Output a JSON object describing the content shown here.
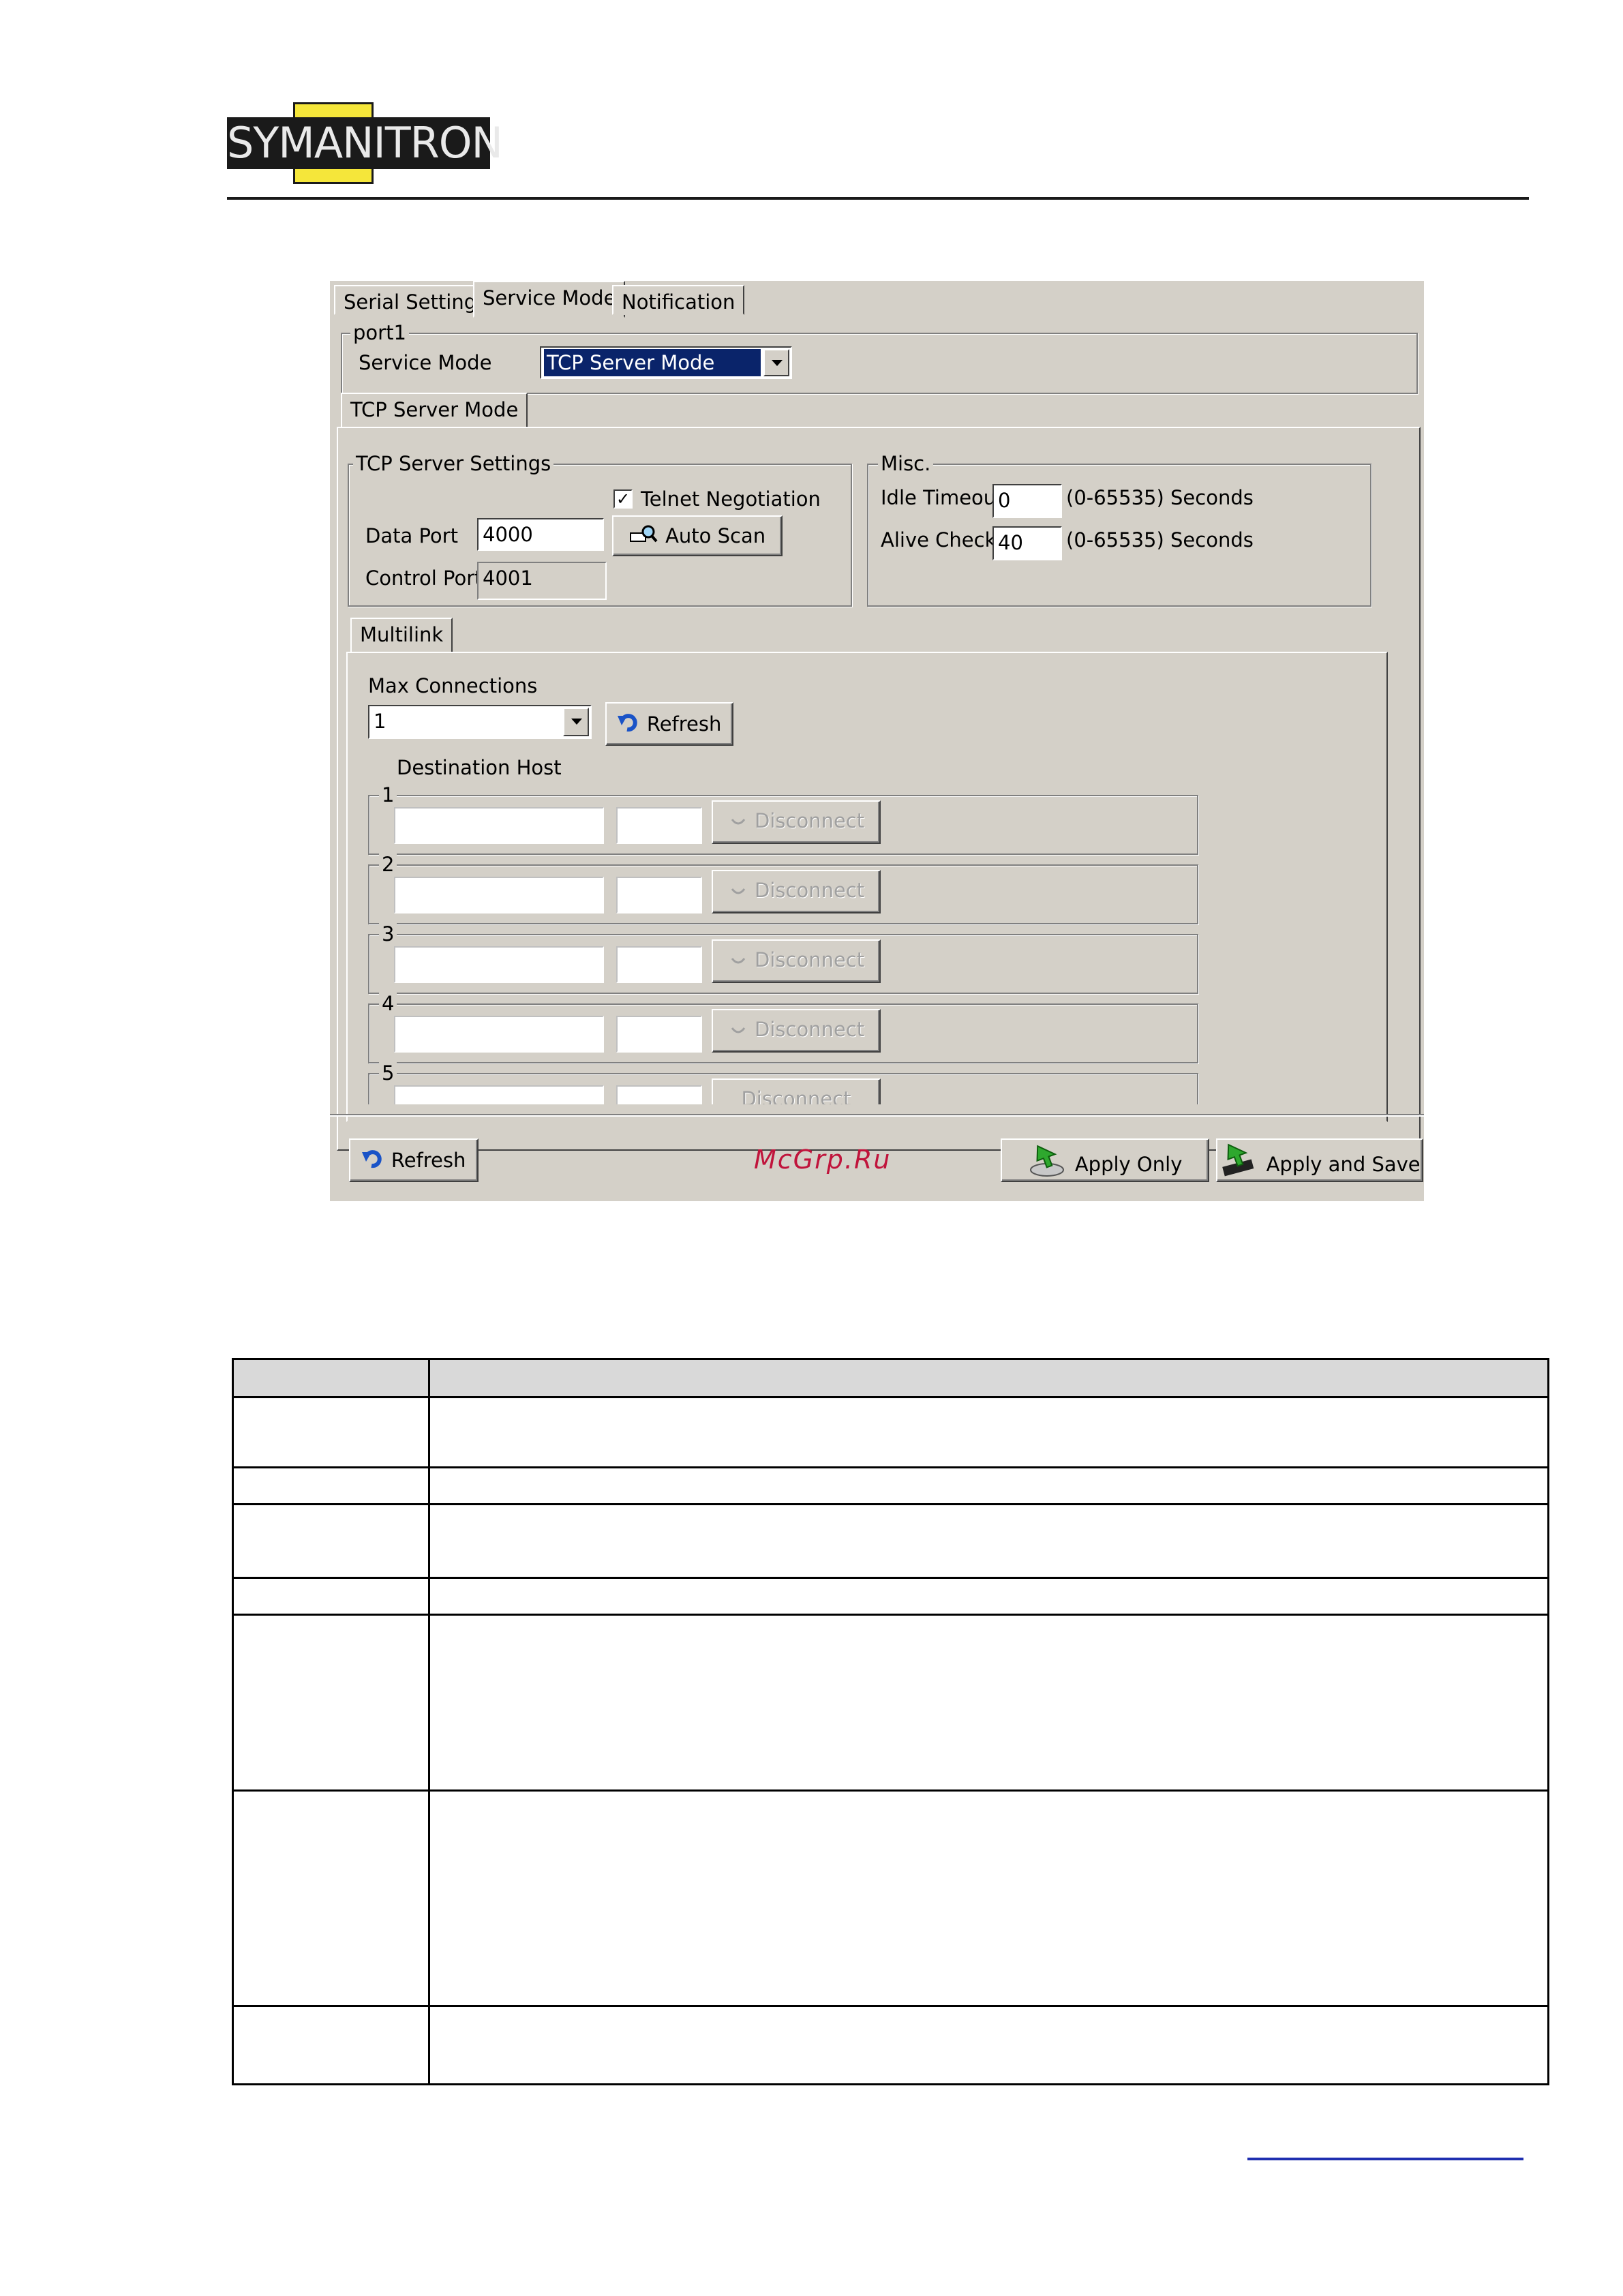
{
  "brand": {
    "logo_text": "SYMANITRON"
  },
  "window": {
    "tabs": [
      "Serial Settings",
      "Service Mode",
      "Notification"
    ],
    "port_group": {
      "legend": "port1",
      "service_mode_label": "Service Mode",
      "service_mode_value": "TCP Server Mode"
    },
    "subtab": "TCP Server Mode",
    "tcp_server": {
      "legend": "TCP Server Settings",
      "telnet_label": "Telnet Negotiation",
      "telnet_checked": true,
      "data_port_label": "Data Port",
      "data_port_value": "4000",
      "auto_scan_label": "Auto Scan",
      "control_port_label": "Control Port",
      "control_port_value": "4001"
    },
    "misc": {
      "legend": "Misc.",
      "idle_timeout_label": "Idle Timeout",
      "idle_timeout_value": "0",
      "idle_timeout_range": "(0-65535) Seconds",
      "alive_check_label": "Alive Check",
      "alive_check_value": "40",
      "alive_check_range": "(0-65535) Seconds"
    },
    "multilink": {
      "tab": "Multilink",
      "max_connections_label": "Max Connections",
      "max_connections_value": "1",
      "refresh_label": "Refresh",
      "destination_host_label": "Destination Host",
      "rows": [
        {
          "num": "1",
          "button": "Disconnect"
        },
        {
          "num": "2",
          "button": "Disconnect"
        },
        {
          "num": "3",
          "button": "Disconnect"
        },
        {
          "num": "4",
          "button": "Disconnect"
        },
        {
          "num": "5",
          "button": "Disconnect"
        }
      ]
    },
    "bottom": {
      "refresh_label": "Refresh",
      "watermark": "McGrp.Ru",
      "apply_only_label": "Apply Only",
      "apply_save_label": "Apply and Save"
    }
  },
  "colors": {
    "window_bg": "#d4d0c8",
    "selection": "#0a246a",
    "watermark": "#c0143c",
    "link": "#1f2fb0"
  }
}
